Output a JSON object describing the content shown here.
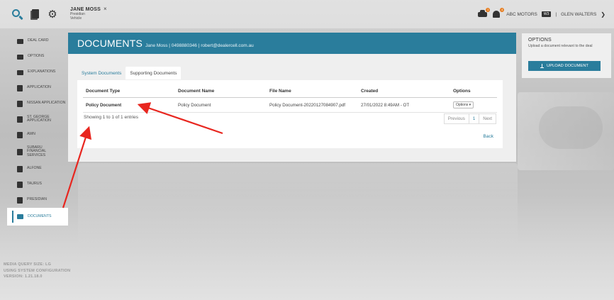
{
  "app": {
    "customer": {
      "name": "JANE MOSS",
      "close": "×",
      "line1": "Presidian",
      "line2": "Vehicle"
    },
    "notifications": {
      "car_count": "1",
      "bell_count": "4"
    },
    "dealer": "ABC MOTORS",
    "dealer_tag": "W3",
    "separator": "|",
    "user": "GLEN WALTERS"
  },
  "sidebar": {
    "items": [
      {
        "label": "DEAL CARD"
      },
      {
        "label": "OPTIONS"
      },
      {
        "label": "EXPLANATIONS"
      },
      {
        "label": "APPLICATION"
      },
      {
        "label": "NISSAN APPLICATION"
      },
      {
        "label": "ST. GEORGE APPLICATION"
      },
      {
        "label": "AWN"
      },
      {
        "label": "SUBARU FINANCIAL SERVICES"
      },
      {
        "label": "ALFONE"
      },
      {
        "label": "TAURUS"
      },
      {
        "label": "PRESIDIAN"
      },
      {
        "label": "DOCUMENTS"
      }
    ]
  },
  "system_info": {
    "line1": "MEDIA QUERY SIZE: LG",
    "line2": "USING SYSTEM CONFIGURATION",
    "line3": "VERSION: 1.21.18.0"
  },
  "documents": {
    "title": "DOCUMENTS",
    "subtitle": "Jane Moss | 0498880346 | robert@dealercell.com.au",
    "tabs": [
      {
        "label": "System Documents"
      },
      {
        "label": "Supporting Documents"
      }
    ],
    "columns": [
      "Document Type",
      "Document Name",
      "File Name",
      "Created",
      "Options"
    ],
    "rows": [
      {
        "type": "Policy Document",
        "name": "Policy Document",
        "file": "Policy Document-20220127084907.pdf",
        "created": "27/01/2022 8:49AM - OT",
        "options": "Options ▾"
      }
    ],
    "entries": "Showing 1 to 1 of 1 entries",
    "pager": {
      "previous": "Previous",
      "current": "1",
      "next": "Next"
    },
    "back": "Back"
  },
  "options_panel": {
    "title": "OPTIONS",
    "description": "Upload a document relevant to the deal",
    "upload_label": "UPLOAD DOCUMENT"
  },
  "colors": {
    "accent": "#2a7d9c",
    "annotation": "#e8261f"
  }
}
